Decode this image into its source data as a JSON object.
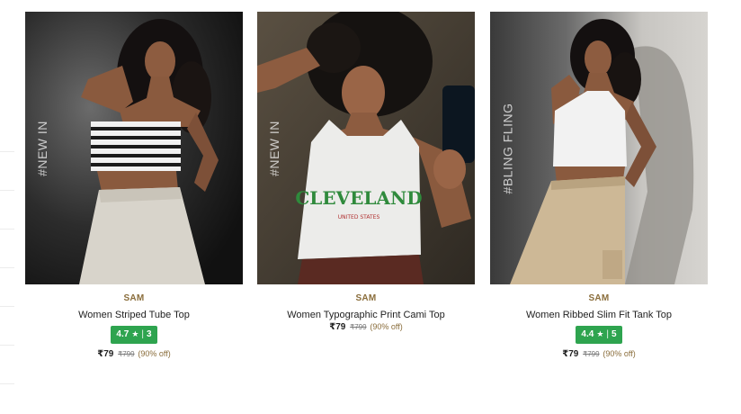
{
  "products": [
    {
      "tag": "#NEW IN",
      "brand": "SAM",
      "title": "Women Striped Tube Top",
      "rating": "4.7",
      "rating_star": "★",
      "rating_sep": "|",
      "rating_count": "3",
      "price": "₹79",
      "mrp": "₹799",
      "discount": "(90% off)"
    },
    {
      "tag": "#NEW IN",
      "brand": "SAM",
      "title": "Women Typographic Print Cami Top",
      "price": "₹79",
      "mrp": "₹799",
      "discount": "(90% off)",
      "shirt_print": "CLEVELAND",
      "shirt_subprint": "UNITED STATES"
    },
    {
      "tag": "#BLING FLING",
      "brand": "SAM",
      "title": "Women Ribbed Slim Fit Tank Top",
      "rating": "4.4",
      "rating_star": "★",
      "rating_sep": "|",
      "rating_count": "5",
      "price": "₹79",
      "mrp": "₹799",
      "discount": "(90% off)"
    }
  ],
  "colors": {
    "rating_bg": "#2ea44f",
    "brand": "#8a6d3b"
  }
}
